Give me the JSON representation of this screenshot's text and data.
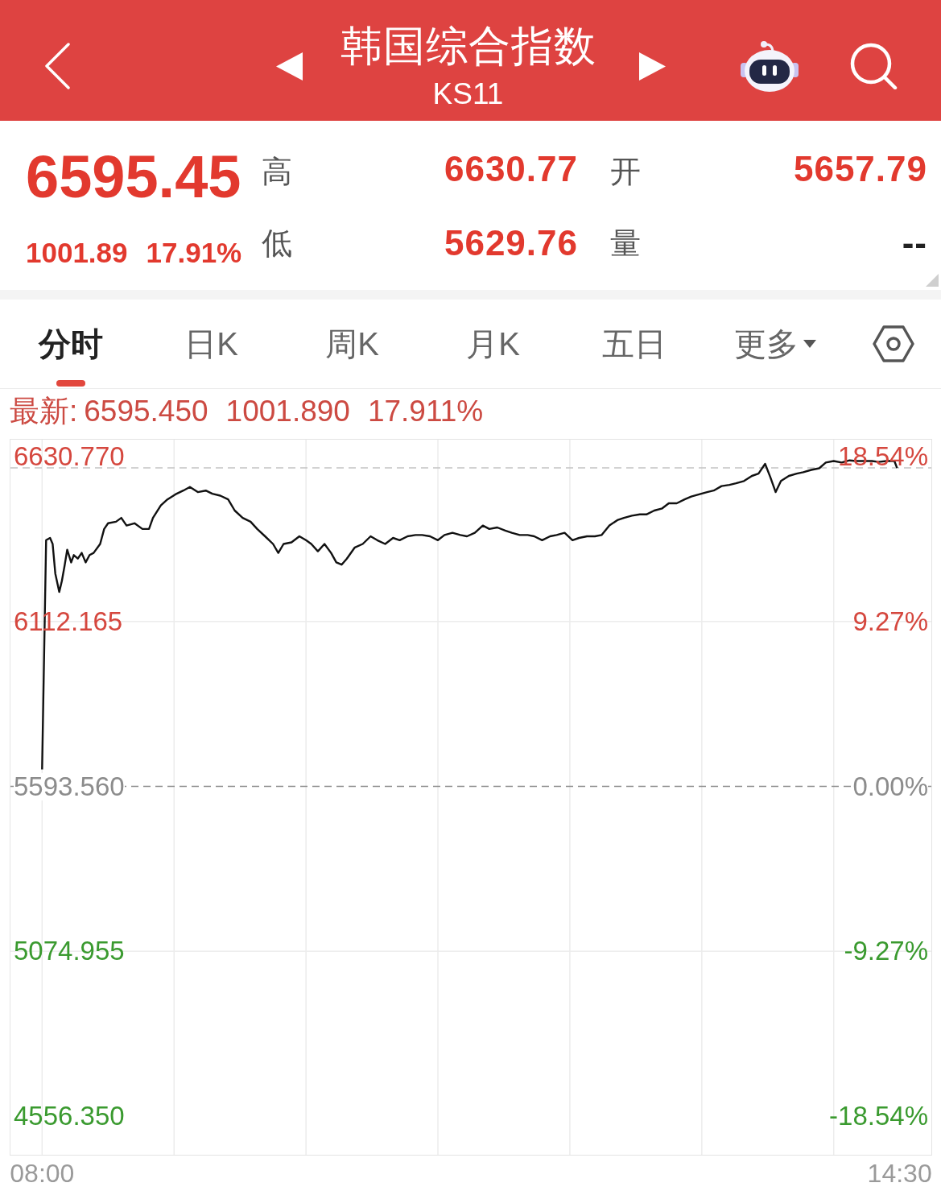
{
  "header": {
    "title": "韩国综合指数",
    "code": "KS11"
  },
  "quote": {
    "price": "6595.45",
    "change": "1001.89",
    "change_percent": "17.91%",
    "stats": [
      {
        "label": "高",
        "value": "6630.77",
        "color": "#e2392e"
      },
      {
        "label": "开",
        "value": "5657.79",
        "color": "#e2392e"
      },
      {
        "label": "低",
        "value": "5629.76",
        "color": "#e2392e"
      },
      {
        "label": "量",
        "value": "--",
        "color": "#222222"
      }
    ]
  },
  "tabs": [
    {
      "label": "分时",
      "selected": true,
      "kind": "tab"
    },
    {
      "label": "日K",
      "selected": false,
      "kind": "tab"
    },
    {
      "label": "周K",
      "selected": false,
      "kind": "tab"
    },
    {
      "label": "月K",
      "selected": false,
      "kind": "tab"
    },
    {
      "label": "五日",
      "selected": false,
      "kind": "tab"
    },
    {
      "label": "更多",
      "selected": false,
      "kind": "menu"
    }
  ],
  "chart": {
    "latest_label": "最新:",
    "latest_values": [
      "6595.450",
      "1001.890",
      "17.911%"
    ],
    "percent_labels": [
      {
        "label": "18.54%",
        "color": "#d5473e"
      },
      {
        "label": "9.27%",
        "color": "#d5473e"
      },
      {
        "label": "0.00%",
        "color": "#8c8c8c"
      },
      {
        "label": "-9.27%",
        "color": "#3a9a2f"
      },
      {
        "label": "-18.54%",
        "color": "#3a9a2f"
      }
    ],
    "chart_data": {
      "type": "line",
      "grid": true,
      "xlim": [
        7.76,
        14.74
      ],
      "ylim": [
        4434.8,
        6684
      ],
      "xticks": [
        {
          "value": 8,
          "label": "08:00"
        },
        {
          "value": 14.5,
          "label": "14:30"
        }
      ],
      "yticks": [
        {
          "value": 6630.77,
          "label": "6630.770"
        },
        {
          "value": 6112.165,
          "label": "6112.165"
        },
        {
          "value": 5593.56,
          "label": "5593.560"
        },
        {
          "value": 5074.955,
          "label": "5074.955"
        },
        {
          "value": 4556.35,
          "label": "4556.350"
        }
      ],
      "ref_lines": [
        {
          "axis": "y",
          "value": 5593.56,
          "color": "#8a8a8a"
        },
        {
          "axis": "y",
          "value": 6595.45,
          "color": "#c4c4c4"
        }
      ],
      "x": [
        8,
        8.03,
        8.06,
        8.08,
        8.1,
        8.13,
        8.15,
        8.17,
        8.19,
        8.22,
        8.24,
        8.27,
        8.3,
        8.33,
        8.36,
        8.39,
        8.44,
        8.47,
        8.5,
        8.56,
        8.6,
        8.64,
        8.7,
        8.76,
        8.81,
        8.84,
        8.9,
        8.95,
        9.01,
        9.07,
        9.12,
        9.18,
        9.24,
        9.29,
        9.35,
        9.41,
        9.46,
        9.52,
        9.58,
        9.63,
        9.69,
        9.75,
        9.79,
        9.83,
        9.89,
        9.95,
        10,
        10.04,
        10.09,
        10.14,
        10.19,
        10.23,
        10.27,
        10.31,
        10.37,
        10.43,
        10.49,
        10.54,
        10.6,
        10.66,
        10.71,
        10.77,
        10.83,
        10.88,
        10.94,
        11,
        11.05,
        11.11,
        11.17,
        11.22,
        11.28,
        11.34,
        11.39,
        11.45,
        11.51,
        11.56,
        11.62,
        11.68,
        11.73,
        11.79,
        11.85,
        11.9,
        11.96,
        12.02,
        12.07,
        12.13,
        12.19,
        12.24,
        12.3,
        12.36,
        12.41,
        12.47,
        12.53,
        12.58,
        12.64,
        12.7,
        12.75,
        12.81,
        12.87,
        12.92,
        12.98,
        13.04,
        13.09,
        13.15,
        13.21,
        13.26,
        13.32,
        13.38,
        13.43,
        13.48,
        13.52,
        13.56,
        13.6,
        13.66,
        13.72,
        13.77,
        13.83,
        13.89,
        13.94,
        14,
        14.06,
        14.12,
        14.17,
        14.23,
        14.29,
        14.34,
        14.4,
        14.46,
        14.48
      ],
      "values": [
        5647,
        6368,
        6375,
        6356,
        6263,
        6205,
        6240,
        6287,
        6338,
        6298,
        6321,
        6310,
        6328,
        6298,
        6321,
        6328,
        6356,
        6403,
        6421,
        6426,
        6438,
        6414,
        6421,
        6403,
        6403,
        6438,
        6477,
        6496,
        6512,
        6524,
        6535,
        6519,
        6524,
        6514,
        6508,
        6496,
        6461,
        6438,
        6426,
        6403,
        6380,
        6356,
        6328,
        6356,
        6361,
        6380,
        6368,
        6356,
        6333,
        6356,
        6328,
        6298,
        6291,
        6310,
        6345,
        6356,
        6380,
        6368,
        6356,
        6375,
        6368,
        6380,
        6384,
        6384,
        6380,
        6368,
        6384,
        6391,
        6384,
        6380,
        6391,
        6414,
        6403,
        6408,
        6398,
        6391,
        6384,
        6384,
        6380,
        6368,
        6380,
        6384,
        6391,
        6368,
        6375,
        6380,
        6380,
        6384,
        6414,
        6431,
        6438,
        6445,
        6449,
        6449,
        6461,
        6468,
        6484,
        6484,
        6496,
        6505,
        6512,
        6519,
        6524,
        6538,
        6542,
        6547,
        6554,
        6570,
        6577,
        6608,
        6566,
        6519,
        6554,
        6570,
        6577,
        6582,
        6589,
        6594,
        6612,
        6617,
        6612,
        6619,
        6617,
        6617,
        6617,
        6614,
        6617,
        6617,
        6595
      ]
    }
  }
}
